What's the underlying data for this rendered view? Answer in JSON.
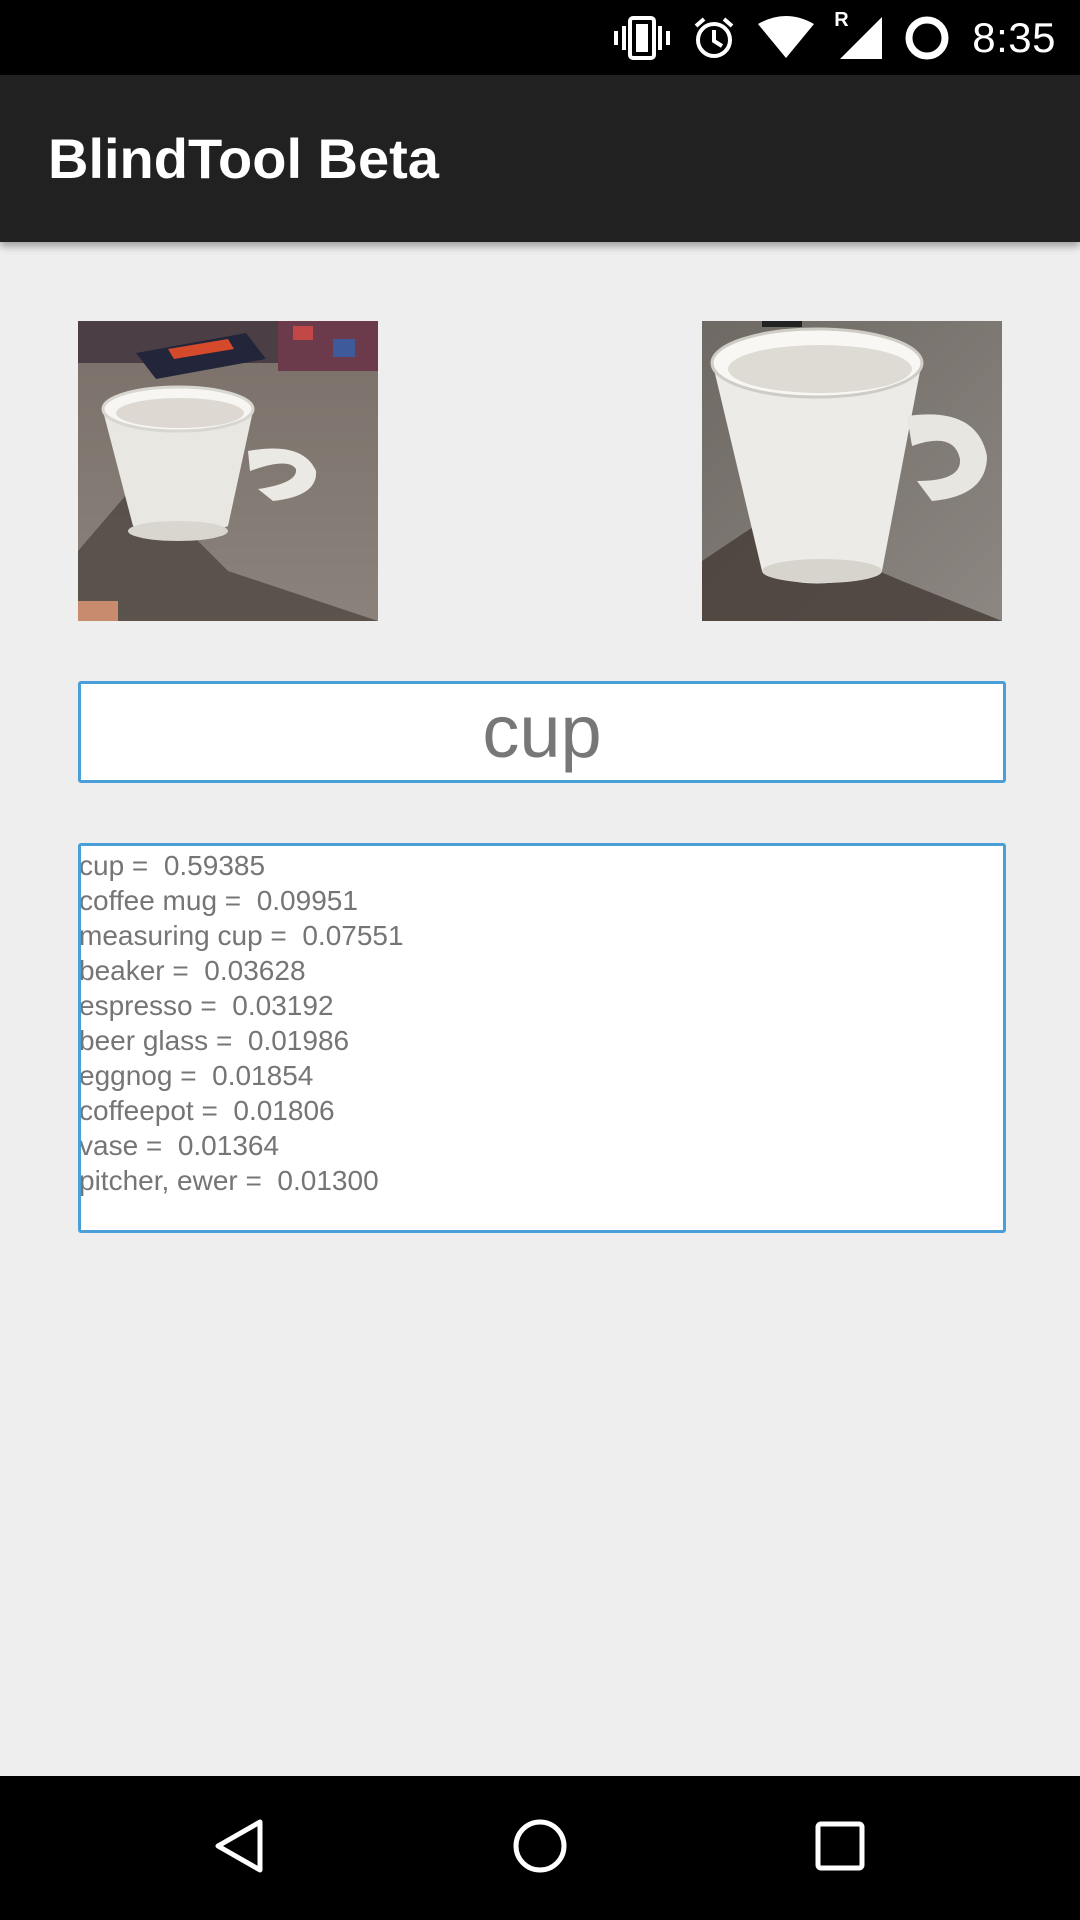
{
  "status_bar": {
    "time": "8:35",
    "icons": [
      "vibrate-icon",
      "alarm-icon",
      "wifi-icon",
      "cell-signal-roaming-icon",
      "battery-charging-icon"
    ],
    "roaming_label": "R"
  },
  "app_bar": {
    "title": "BlindTool Beta"
  },
  "images": {
    "left": "camera-frame-cup-wide",
    "right": "camera-frame-cup-cropped"
  },
  "result": {
    "label": "cup"
  },
  "predictions": [
    {
      "text": "cup =  0.59385"
    },
    {
      "text": "coffee mug =  0.09951"
    },
    {
      "text": "measuring cup =  0.07551"
    },
    {
      "text": "beaker =  0.03628"
    },
    {
      "text": "espresso =  0.03192"
    },
    {
      "text": "beer glass =  0.01986"
    },
    {
      "text": "eggnog =  0.01854"
    },
    {
      "text": "coffeepot =  0.01806"
    },
    {
      "text": "vase =  0.01364"
    },
    {
      "text": "pitcher, ewer =  0.01300"
    }
  ],
  "nav_bar": {
    "buttons": [
      "back-icon",
      "home-icon",
      "recents-icon"
    ]
  },
  "colors": {
    "accent": "#4a9fd8",
    "app_bar": "#212121",
    "background": "#eeeeee"
  }
}
